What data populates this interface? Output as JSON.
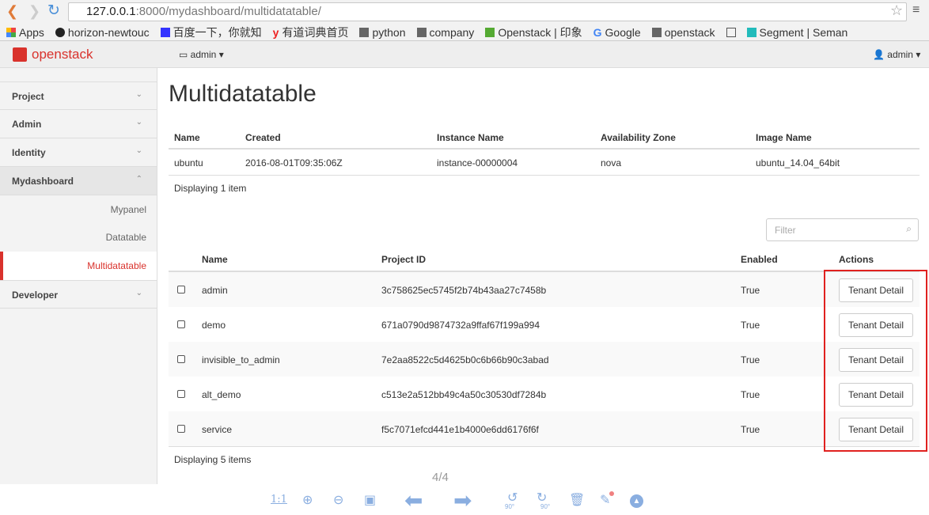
{
  "browser": {
    "url_host": "127.0.0.1",
    "url_path": ":8000/mydashboard/multidatatable/",
    "bookmarks": [
      "Apps",
      "horizon-newtouc",
      "百度一下，你就知",
      "有道词典首页",
      "python",
      "company",
      "Openstack | 印象",
      "Google",
      "openstack",
      "",
      "Segment | Seman"
    ]
  },
  "header": {
    "logo": "openstack",
    "project_label": "admin",
    "user_label": "admin"
  },
  "sidebar": {
    "items": [
      {
        "label": "Project",
        "chev": "⌄"
      },
      {
        "label": "Admin",
        "chev": "⌄"
      },
      {
        "label": "Identity",
        "chev": "⌄"
      },
      {
        "label": "Mydashboard",
        "chev": "⌃"
      },
      {
        "label": "Developer",
        "chev": "⌄"
      }
    ],
    "subitems": [
      "Mypanel",
      "Datatable",
      "Multidatatable"
    ]
  },
  "page_title": "Multidatatable",
  "table1": {
    "headers": [
      "Name",
      "Created",
      "Instance Name",
      "Availability Zone",
      "Image Name"
    ],
    "rows": [
      [
        "ubuntu",
        "2016-08-01T09:35:06Z",
        "instance-00000004",
        "nova",
        "ubuntu_14.04_64bit"
      ]
    ],
    "footer": "Displaying 1 item"
  },
  "table2": {
    "filter_placeholder": "Filter",
    "headers": [
      "Name",
      "Project ID",
      "Enabled",
      "Actions"
    ],
    "rows": [
      {
        "name": "admin",
        "id": "3c758625ec5745f2b74b43aa27c7458b",
        "enabled": "True",
        "action": "Tenant Detail"
      },
      {
        "name": "demo",
        "id": "671a0790d9874732a9ffaf67f199a994",
        "enabled": "True",
        "action": "Tenant Detail"
      },
      {
        "name": "invisible_to_admin",
        "id": "7e2aa8522c5d4625b0c6b66b90c3abad",
        "enabled": "True",
        "action": "Tenant Detail"
      },
      {
        "name": "alt_demo",
        "id": "c513e2a512bb49c4a50c30530df7284b",
        "enabled": "True",
        "action": "Tenant Detail"
      },
      {
        "name": "service",
        "id": "f5c7071efcd441e1b4000e6dd6176f6f",
        "enabled": "True",
        "action": "Tenant Detail"
      }
    ],
    "footer": "Displaying 5 items"
  },
  "viewer": {
    "page": "4/4",
    "actual_size": "1:1",
    "rotate_label": "90°"
  },
  "colors": {
    "accent": "#d9322c",
    "highlight_box": "#e0211f",
    "viewer_icon": "#8aaee0"
  }
}
